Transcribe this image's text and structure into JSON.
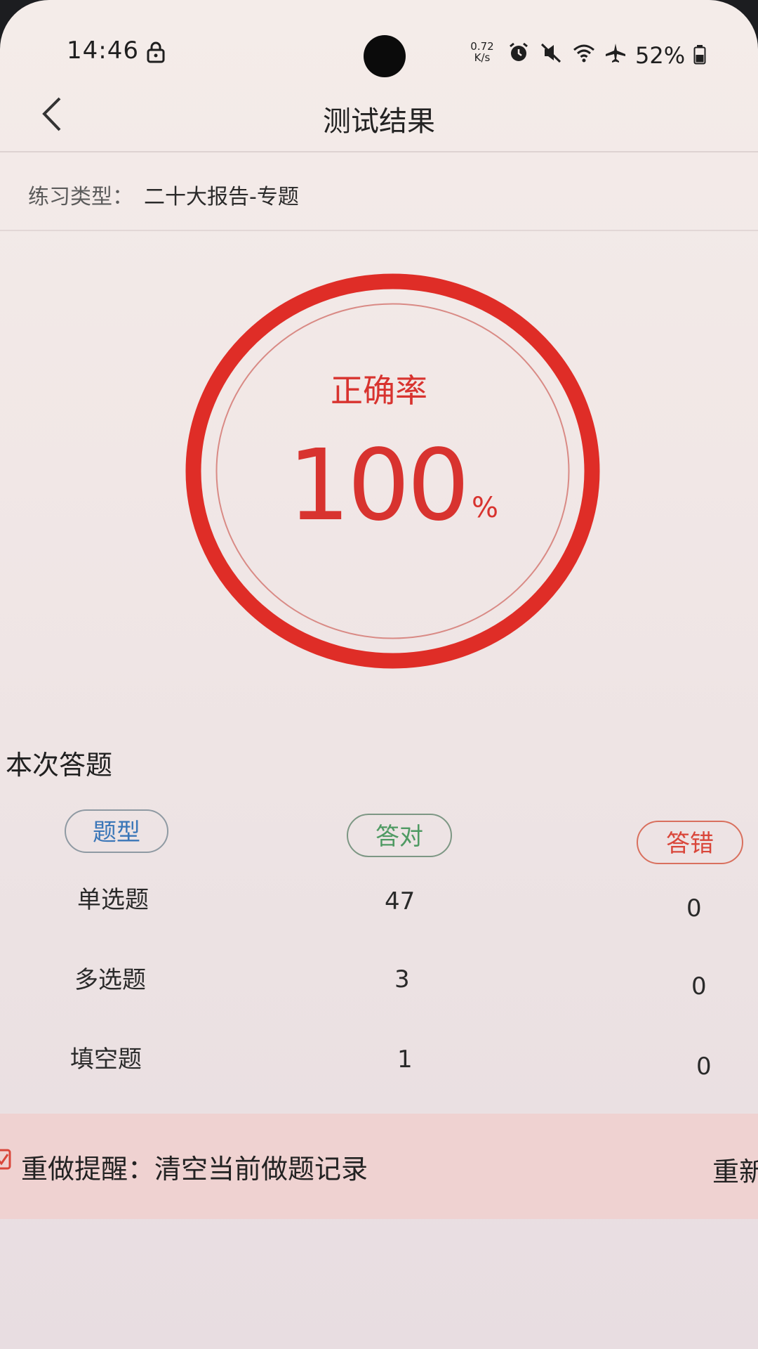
{
  "status_bar": {
    "time": "14:46",
    "net_speed_value": "0.72",
    "net_speed_unit": "K/s",
    "battery": "52%",
    "icons": [
      "lock-icon",
      "alarm-icon",
      "mute-icon",
      "wifi-icon",
      "airplane-icon",
      "battery-icon"
    ]
  },
  "header": {
    "back_icon": "chevron-left-icon",
    "title": "测试结果"
  },
  "practice": {
    "label": "练习类型：",
    "value": "二十大报告-专题"
  },
  "accuracy": {
    "label": "正确率",
    "value": "100",
    "unit": "%",
    "fraction": 1.0
  },
  "results": {
    "section_title": "本次答题",
    "headers": {
      "type": "题型",
      "correct": "答对",
      "wrong": "答错"
    },
    "rows": [
      {
        "type": "单选题",
        "correct": "47",
        "wrong": "0"
      },
      {
        "type": "多选题",
        "correct": "3",
        "wrong": "0"
      },
      {
        "type": "填空题",
        "correct": "1",
        "wrong": "0"
      }
    ]
  },
  "reminder": {
    "text": "重做提醒：清空当前做题记录",
    "action": "重新"
  },
  "colors": {
    "accent_red": "#d8332f",
    "correct_green": "#4f9a63",
    "type_blue": "#3a76b8",
    "reminder_bg": "#efd2d1"
  }
}
